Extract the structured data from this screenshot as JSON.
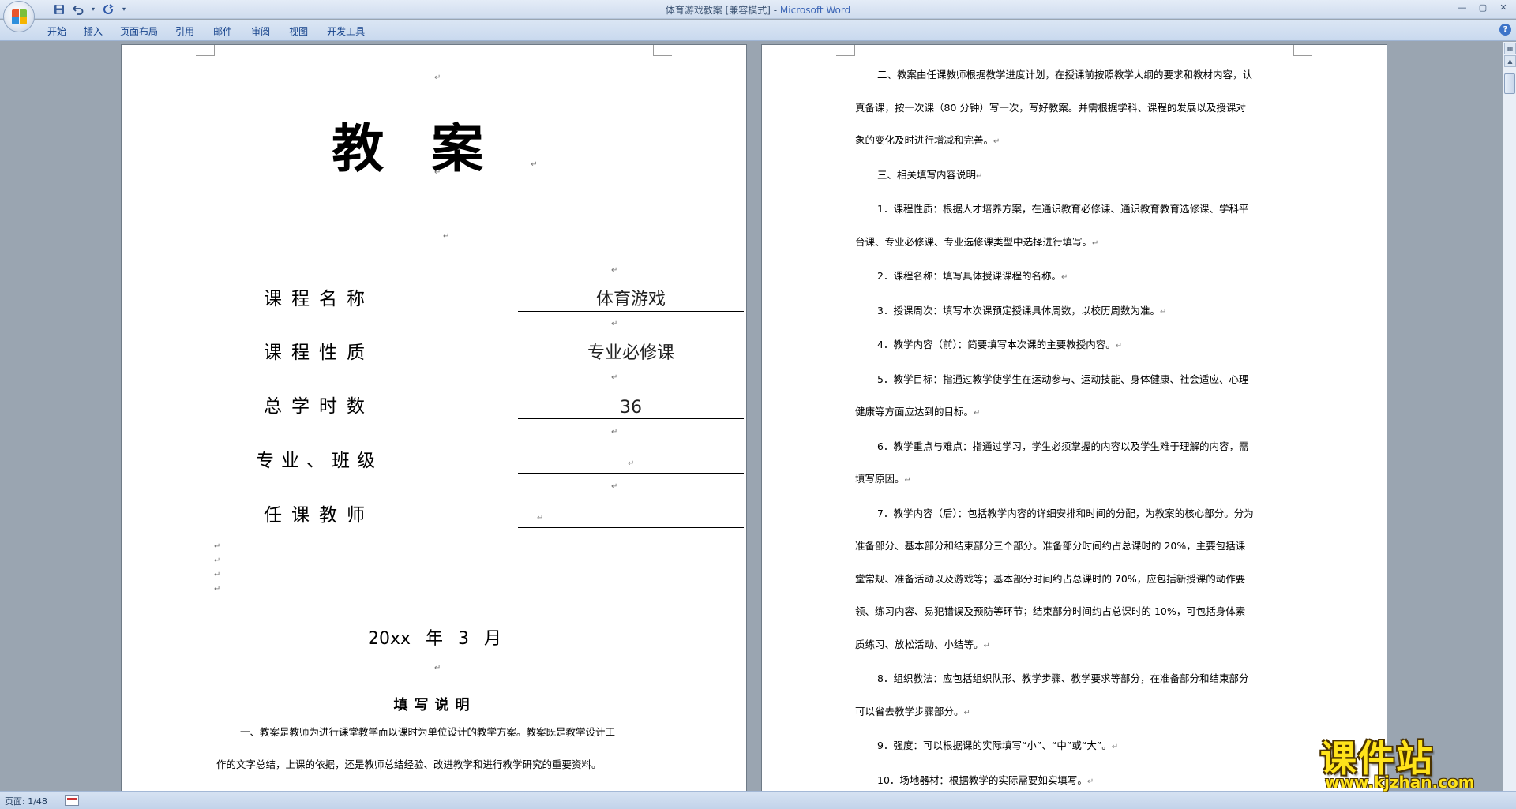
{
  "window": {
    "title_main": "体育游戏教案 [兼容模式] - ",
    "title_app": "Microsoft Word",
    "controls": [
      "—",
      "▢",
      "✕"
    ]
  },
  "qat": {
    "save": "save-icon",
    "undo": "undo-icon",
    "redo": "redo-icon",
    "more": "▾"
  },
  "ribbon": {
    "tabs": [
      "开始",
      "插入",
      "页面布局",
      "引用",
      "邮件",
      "审阅",
      "视图",
      "开发工具"
    ],
    "help": "?"
  },
  "mark": "↵",
  "left_page": {
    "title": "教案",
    "fields": [
      {
        "label": "课程名称",
        "value": "体育游戏"
      },
      {
        "label": "课程性质",
        "value": "专业必修课"
      },
      {
        "label": "总学时数",
        "value": "36"
      },
      {
        "label": "专业、班级",
        "value": ""
      },
      {
        "label": "任课教师",
        "value": ""
      }
    ],
    "date": "20xx 年 3 月",
    "section_heading": "填写说明",
    "para1_line1": "一、教案是教师为进行课堂教学而以课时为单位设计的教学方案。教案既是教学设计工",
    "para1_line2": "作的文字总结，上课的依据，还是教师总结经验、改进教学和进行教学研究的重要资料。"
  },
  "right_page": {
    "lines": [
      {
        "text": "二、教案由任课教师根据教学进度计划，在授课前按照教学大纲的要求和教材内容，认",
        "indent": true,
        "mark": false
      },
      {
        "text": "真备课，按一次课（80 分钟）写一次，写好教案。并需根据学科、课程的发展以及授课对",
        "indent": false,
        "mark": false
      },
      {
        "text": "象的变化及时进行增减和完善。",
        "indent": false,
        "mark": true
      },
      {
        "text": "三、相关填写内容说明",
        "indent": true,
        "mark": true
      },
      {
        "text": "1．课程性质：根据人才培养方案，在通识教育必修课、通识教育教育选修课、学科平",
        "indent": true,
        "mark": false
      },
      {
        "text": "台课、专业必修课、专业选修课类型中选择进行填写。",
        "indent": false,
        "mark": true
      },
      {
        "text": "2．课程名称：填写具体授课课程的名称。",
        "indent": true,
        "mark": true
      },
      {
        "text": "3．授课周次：填写本次课预定授课具体周数，以校历周数为准。",
        "indent": true,
        "mark": true
      },
      {
        "text": "4．教学内容（前）：简要填写本次课的主要教授内容。",
        "indent": true,
        "mark": true
      },
      {
        "text": "5．教学目标：指通过教学使学生在运动参与、运动技能、身体健康、社会适应、心理",
        "indent": true,
        "mark": false
      },
      {
        "text": "健康等方面应达到的目标。",
        "indent": false,
        "mark": true
      },
      {
        "text": "6．教学重点与难点：指通过学习，学生必须掌握的内容以及学生难于理解的内容，需",
        "indent": true,
        "mark": false
      },
      {
        "text": "填写原因。",
        "indent": false,
        "mark": true
      },
      {
        "text": "7．教学内容（后）：包括教学内容的详细安排和时间的分配，为教案的核心部分。分为",
        "indent": true,
        "mark": false
      },
      {
        "text": "准备部分、基本部分和结束部分三个部分。准备部分时间约占总课时的 20%，主要包括课",
        "indent": false,
        "mark": false
      },
      {
        "text": "堂常规、准备活动以及游戏等；基本部分时间约占总课时的 70%，应包括新授课的动作要",
        "indent": false,
        "mark": false
      },
      {
        "text": "领、练习内容、易犯错误及预防等环节；结束部分时间约占总课时的 10%，可包括身体素",
        "indent": false,
        "mark": false
      },
      {
        "text": "质练习、放松活动、小结等。",
        "indent": false,
        "mark": true
      },
      {
        "text": "8．组织教法：应包括组织队形、教学步骤、教学要求等部分，在准备部分和结束部分",
        "indent": true,
        "mark": false
      },
      {
        "text": "可以省去教学步骤部分。",
        "indent": false,
        "mark": true
      },
      {
        "text": "9．强度：可以根据课的实际填写“小”、“中”或“大”。",
        "indent": true,
        "mark": true
      },
      {
        "text": "10．场地器材：根据教学的实际需要如实填写。",
        "indent": true,
        "mark": true
      }
    ]
  },
  "statusbar": {
    "page": "页面: 1/48"
  },
  "watermark": {
    "big": "课件站",
    "small": "www.kjzhan.com"
  }
}
